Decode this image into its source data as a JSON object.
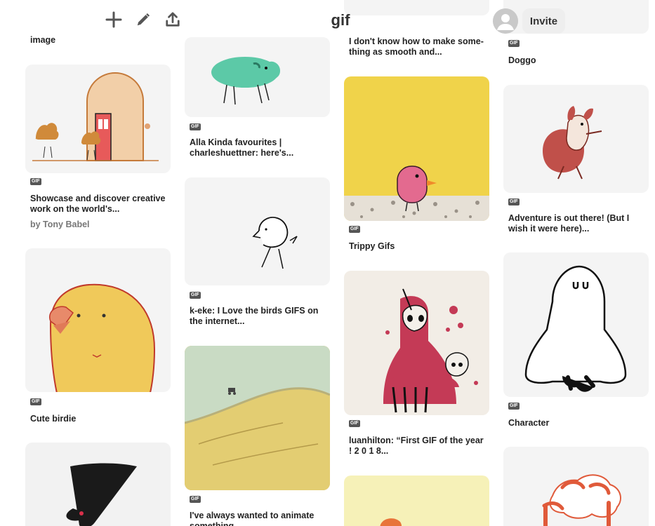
{
  "header": {
    "board_title": "gif",
    "invite_label": "Invite",
    "add_icon": "plus-icon",
    "edit_icon": "pencil-icon",
    "share_icon": "share-upload-icon"
  },
  "badge_label": "GIF",
  "columns": [
    {
      "pins": [
        {
          "title": "image"
        },
        {
          "title": "Showcase and discover creative work on the world's...",
          "subtitle": "by Tony Babel"
        },
        {
          "title": "Cute birdie"
        },
        {
          "title": ""
        }
      ]
    },
    {
      "pins": [
        {
          "title": "Alla Kinda favourites | charleshuettner: here's..."
        },
        {
          "title": "k-eke: I Love the birds GIFS on the internet..."
        },
        {
          "title": "I've always wanted to animate something..."
        }
      ]
    },
    {
      "pins": [
        {
          "title": "I don't know how to make some-thing as smooth and..."
        },
        {
          "title": "Trippy Gifs"
        },
        {
          "title": "luanhilton: “First GIF of the year ! 2 0 1 8..."
        },
        {
          "title": ""
        }
      ]
    },
    {
      "pins": [
        {
          "title": "Doggo"
        },
        {
          "title": "Adventure is out there! (But I wish it were here)..."
        },
        {
          "title": "Character"
        },
        {
          "title": ""
        }
      ]
    }
  ],
  "colors": {
    "accent_red": "#d9304a",
    "yellow_bg": "#f0d34a",
    "card_bg": "#f4f4f4"
  }
}
